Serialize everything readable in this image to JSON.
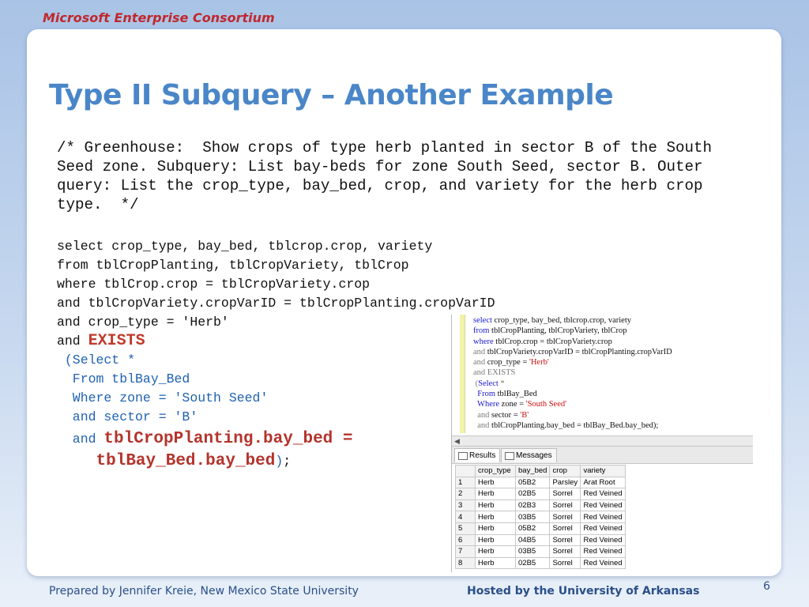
{
  "header": {
    "brand": "Microsoft Enterprise Consortium"
  },
  "slide": {
    "title": "Type II Subquery – Another Example"
  },
  "comment_lines": [
    "/* Greenhouse:  Show crops of type herb planted in sector B of the South",
    "Seed zone. Subquery: List bay-beds for zone South Seed, sector B. Outer",
    "query: List the crop_type, bay_bed, crop, and variety for the herb crop",
    "type.  */"
  ],
  "sql": {
    "line1": "select crop_type, bay_bed, tblcrop.crop, variety",
    "line2": "from tblCropPlanting, tblCropVariety, tblCrop",
    "line3": "where tblCrop.crop = tblCropVariety.crop",
    "line4": "and tblCropVariety.cropVarID = tblCropPlanting.cropVarID",
    "line5": "and crop_type = 'Herb'",
    "and_word": "and ",
    "exists": "EXISTS",
    "select": " (Select *",
    "from": "  From tblBay_Bed",
    "where": "  Where zone = 'South Seed'",
    "sector": "  and sector = 'B'",
    "and2": "  and ",
    "join1": "tblCropPlanting.bay_bed =",
    "join2_indent": "     ",
    "join2": "tblBay_Bed.bay_bed",
    "close_paren": ")",
    "semicolon": ";"
  },
  "ssms": {
    "code": {
      "l1_kw": "select",
      "l1_rest": " crop_type, bay_bed, tblcrop.crop, variety",
      "l2_kw": "from",
      "l2_rest": " tblCropPlanting, tblCropVariety, tblCrop",
      "l3_kw": "where",
      "l3_rest": " tblCrop.crop = tblCropVariety.crop",
      "l4_kw": "and",
      "l4_rest": " tblCropVariety.cropVarID = tblCropPlanting.cropVarID",
      "l5_kw": "and",
      "l5_mid": " crop_type = ",
      "l5_str": "'Herb'",
      "l6": "and EXISTS",
      "l7_paren": " (",
      "l7_kw": "Select",
      "l7_rest": " *",
      "l8_kw": "  From",
      "l8_rest": " tblBay_Bed",
      "l9_kw": "  Where",
      "l9_rest": " zone = ",
      "l9_str": "'South Seed'",
      "l10_kw": "  and",
      "l10_rest": " sector = ",
      "l10_str": "'B'",
      "l11_kw": "  and",
      "l11_rest": " tblCropPlanting.bay_bed = tblBay_Bed.bay_bed);"
    },
    "tabs": {
      "results": "Results",
      "messages": "Messages"
    },
    "grid": {
      "columns": [
        "crop_type",
        "bay_bed",
        "crop",
        "variety"
      ],
      "rows": [
        [
          "1",
          "Herb",
          "05B2",
          "Parsley",
          "Arat Root"
        ],
        [
          "2",
          "Herb",
          "02B5",
          "Sorrel",
          "Red Veined"
        ],
        [
          "3",
          "Herb",
          "02B3",
          "Sorrel",
          "Red Veined"
        ],
        [
          "4",
          "Herb",
          "03B5",
          "Sorrel",
          "Red Veined"
        ],
        [
          "5",
          "Herb",
          "05B2",
          "Sorrel",
          "Red Veined"
        ],
        [
          "6",
          "Herb",
          "04B5",
          "Sorrel",
          "Red Veined"
        ],
        [
          "7",
          "Herb",
          "03B5",
          "Sorrel",
          "Red Veined"
        ],
        [
          "8",
          "Herb",
          "02B5",
          "Sorrel",
          "Red Veined"
        ]
      ]
    }
  },
  "footer": {
    "left": "Prepared by Jennifer Kreie, New Mexico State University",
    "right": "Hosted by the University of Arkansas",
    "page": "6"
  }
}
